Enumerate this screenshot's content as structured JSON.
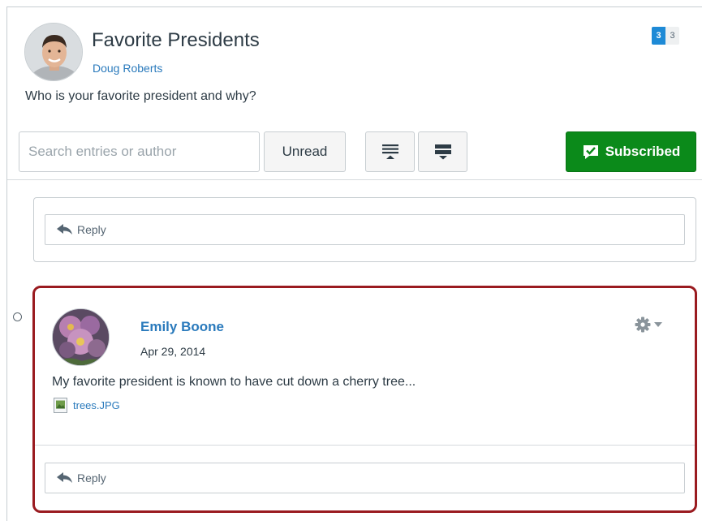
{
  "topic": {
    "title": "Favorite Presidents",
    "author": "Doug Roberts",
    "question": "Who is your favorite president and why?",
    "unread_count": "3",
    "total_count": "3"
  },
  "toolbar": {
    "search_placeholder": "Search entries or author",
    "unread_label": "Unread",
    "subscribed_label": "Subscribed"
  },
  "reply_label": "Reply",
  "entry": {
    "author": "Emily Boone",
    "date": "Apr 29, 2014",
    "message": "My favorite president is known to have cut down a cherry tree...",
    "attachment": "trees.JPG"
  },
  "colors": {
    "link": "#2a7abc",
    "subscribed_green": "#0b8a1a",
    "highlight_border": "#9a1b20",
    "unread_badge": "#1e8ad6"
  },
  "icons": {
    "collapse": "collapse-all-icon",
    "expand": "expand-all-icon",
    "subscribed": "check-comment-icon",
    "reply": "reply-arrow-icon",
    "settings": "gear-icon",
    "attachment": "image-file-icon"
  }
}
